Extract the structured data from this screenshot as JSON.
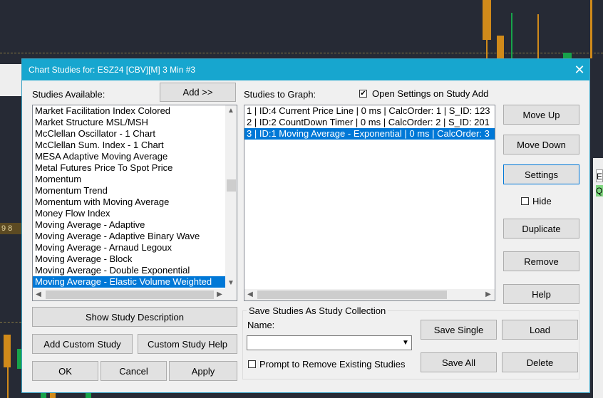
{
  "dialog": {
    "title": "Chart Studies for: ESZ24 [CBV][M]  3 Min  #3",
    "close_glyph": "✕"
  },
  "available": {
    "label": "Studies Available:",
    "add_button": "Add >>",
    "items": [
      "Market Facilitation Index Colored",
      "Market Structure MSL/MSH",
      "McClellan Oscillator - 1 Chart",
      "McClellan Sum. Index - 1 Chart",
      "MESA Adaptive Moving Average",
      "Metal Futures Price To Spot Price",
      "Momentum",
      "Momentum Trend",
      "Momentum with Moving Average",
      "Money Flow Index",
      "Moving Average - Adaptive",
      "Moving Average - Adaptive Binary Wave",
      "Moving Average - Arnaud Legoux",
      "Moving Average - Block",
      "Moving Average - Double Exponential",
      "Moving Average - Elastic Volume Weighted"
    ],
    "selected_index": 15
  },
  "graph": {
    "label": "Studies to Graph:",
    "open_settings_label": "Open Settings on Study Add",
    "open_settings_checked": true,
    "items": [
      "1 | ID:4  Current Price Line | 0 ms | CalcOrder: 1 | S_ID: 123",
      "2 | ID:2  CountDown Timer | 0 ms | CalcOrder: 2 | S_ID: 201",
      "3 | ID:1  Moving Average - Exponential | 0 ms | CalcOrder: 3"
    ],
    "selected_index": 2
  },
  "right_buttons": {
    "move_up": "Move Up",
    "move_down": "Move Down",
    "settings": "Settings",
    "hide": "Hide",
    "duplicate": "Duplicate",
    "remove": "Remove",
    "help": "Help"
  },
  "bottom_left": {
    "show_desc": "Show Study Description",
    "add_custom": "Add Custom Study",
    "custom_help": "Custom Study Help",
    "ok": "OK",
    "cancel": "Cancel",
    "apply": "Apply"
  },
  "collection": {
    "group_label": "Save Studies As Study Collection",
    "name_label": "Name:",
    "name_value": "",
    "prompt_label": "Prompt to Remove Existing Studies",
    "prompt_checked": false,
    "save_single": "Save Single",
    "load": "Load",
    "save_all": "Save All",
    "delete": "Delete"
  },
  "scroll_glyphs": {
    "up": "▲",
    "down": "▼",
    "left": "◀",
    "right": "▶"
  },
  "background": {
    "left_strip_text": "9 8",
    "right_strip_text": [
      "E",
      "Q"
    ],
    "colors": {
      "candle_up": "#17a34a",
      "candle_down": "#d08a1a",
      "accent": "#17a6cf"
    }
  }
}
